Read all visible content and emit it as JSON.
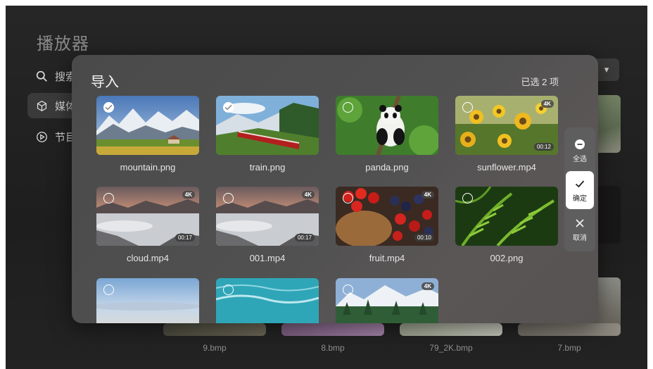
{
  "app": {
    "title": "播放器"
  },
  "sidebar": {
    "items": [
      {
        "label": "搜索",
        "icon": "search-icon"
      },
      {
        "label": "媒体",
        "icon": "cube-icon"
      },
      {
        "label": "节目",
        "icon": "play-circle-icon"
      }
    ]
  },
  "background_grid": {
    "labels": [
      "9.bmp",
      "8.bmp",
      "79_2K.bmp",
      "7.bmp"
    ]
  },
  "dialog": {
    "title": "导入",
    "selected_count": "已选 2 项",
    "items": [
      {
        "name": "mountain.png",
        "selected": true
      },
      {
        "name": "train.png",
        "selected": true
      },
      {
        "name": "panda.png",
        "selected": false
      },
      {
        "name": "sunflower.mp4",
        "selected": false,
        "badge": "4K",
        "duration": "00:12"
      },
      {
        "name": "cloud.mp4",
        "selected": false,
        "badge": "4K",
        "duration": "00:17"
      },
      {
        "name": "001.mp4",
        "selected": false,
        "badge": "4K",
        "duration": "00:17"
      },
      {
        "name": "fruit.mp4",
        "selected": false,
        "badge": "4K",
        "duration": "00:10"
      },
      {
        "name": "002.png",
        "selected": false
      },
      {
        "name": "",
        "selected": false
      },
      {
        "name": "",
        "selected": false
      },
      {
        "name": "",
        "selected": false,
        "badge": "4K"
      }
    ]
  },
  "actions": {
    "select_all": "全选",
    "confirm": "确定",
    "cancel": "取消"
  }
}
